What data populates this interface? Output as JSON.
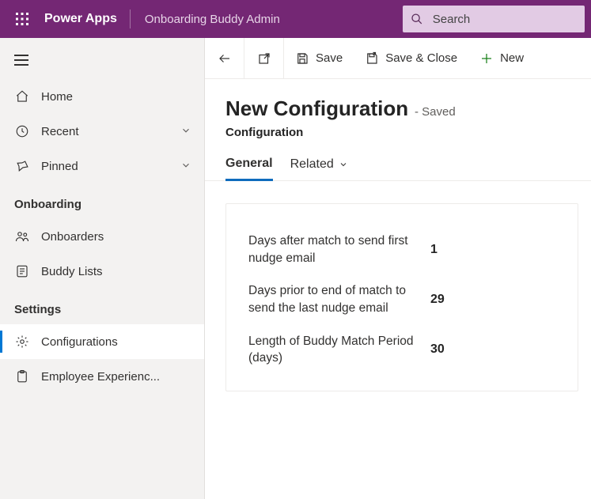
{
  "header": {
    "brand": "Power Apps",
    "app_name": "Onboarding Buddy Admin",
    "search_placeholder": "Search"
  },
  "sidebar": {
    "items_top": [
      {
        "key": "home",
        "label": "Home",
        "chev": false
      },
      {
        "key": "recent",
        "label": "Recent",
        "chev": true
      },
      {
        "key": "pinned",
        "label": "Pinned",
        "chev": true
      }
    ],
    "sections": [
      {
        "title": "Onboarding",
        "items": [
          {
            "key": "onboarders",
            "label": "Onboarders"
          },
          {
            "key": "buddy-lists",
            "label": "Buddy Lists"
          }
        ]
      },
      {
        "title": "Settings",
        "items": [
          {
            "key": "configurations",
            "label": "Configurations",
            "active": true
          },
          {
            "key": "employee-exp",
            "label": "Employee Experienc..."
          }
        ]
      }
    ]
  },
  "commands": {
    "save": "Save",
    "save_close": "Save & Close",
    "new": "New"
  },
  "page": {
    "title": "New Configuration",
    "status": "- Saved",
    "entity": "Configuration"
  },
  "tabs": {
    "general": "General",
    "related": "Related"
  },
  "fields": [
    {
      "label": "Days after match to send first nudge email",
      "value": "1"
    },
    {
      "label": "Days prior to end of match to send the last nudge email",
      "value": "29"
    },
    {
      "label": "Length of Buddy Match Period (days)",
      "value": "30"
    }
  ]
}
